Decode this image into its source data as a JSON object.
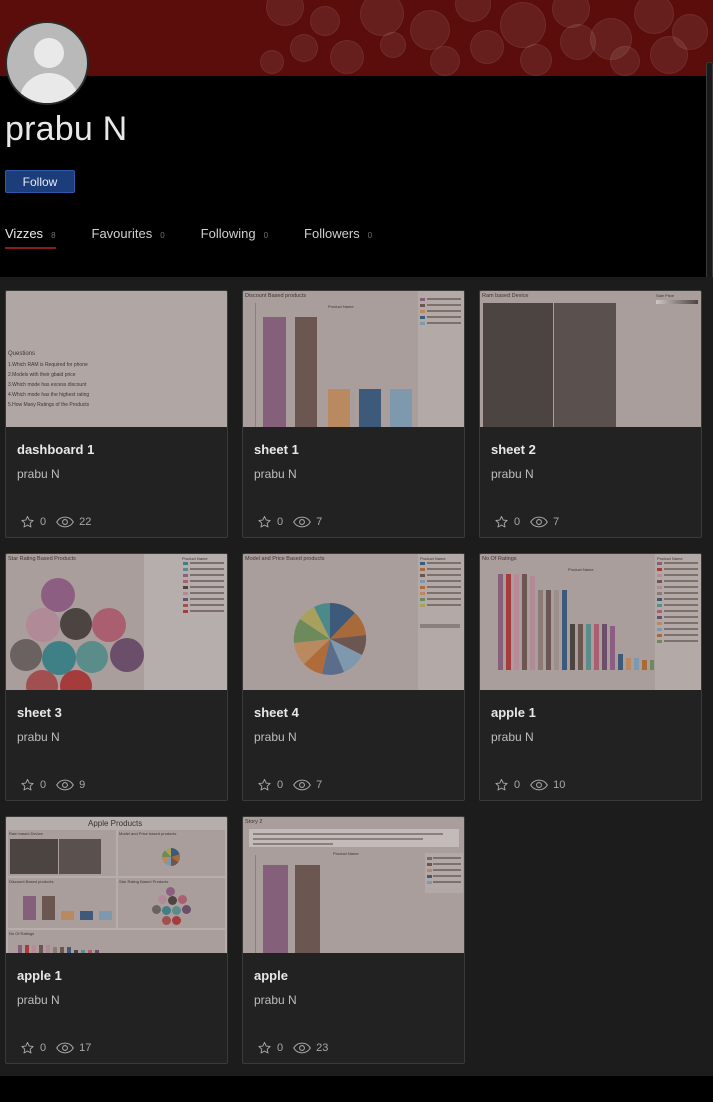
{
  "profile": {
    "name": "prabu N",
    "follow_label": "Follow"
  },
  "tabs": [
    {
      "label": "Vizzes",
      "count": "8",
      "active": true
    },
    {
      "label": "Favourites",
      "count": "0",
      "active": false
    },
    {
      "label": "Following",
      "count": "0",
      "active": false
    },
    {
      "label": "Followers",
      "count": "0",
      "active": false
    }
  ],
  "cards": [
    {
      "title": "dashboard 1",
      "author": "prabu N",
      "favorites": "0",
      "views": "22",
      "thumb": {
        "heading": "Questions",
        "lines": [
          "1.Which RAM is Required for phone",
          "2.Models with their gbaid price",
          "3.Which mode has excess discount",
          "4.Which mode has the highest rating",
          "5.How Many Ratings of the Products"
        ]
      }
    },
    {
      "title": "sheet 1",
      "author": "prabu N",
      "favorites": "0",
      "views": "7",
      "thumb": {
        "heading": "Discount Based products",
        "subheading": "Product Name"
      }
    },
    {
      "title": "sheet 2",
      "author": "prabu N",
      "favorites": "0",
      "views": "7",
      "thumb": {
        "heading": "Ram based Device",
        "legend_title": "Sale Price"
      }
    },
    {
      "title": "sheet 3",
      "author": "prabu N",
      "favorites": "0",
      "views": "9",
      "thumb": {
        "heading": "Star Rating Based Products",
        "legend_title": "Product Name"
      }
    },
    {
      "title": "sheet 4",
      "author": "prabu N",
      "favorites": "0",
      "views": "7",
      "thumb": {
        "heading": "Model and Price Based products",
        "legend_title": "Product Name"
      }
    },
    {
      "title": "apple 1",
      "author": "prabu N",
      "favorites": "0",
      "views": "10",
      "thumb": {
        "heading": "No Of Ratings",
        "subheading": "Product Name",
        "legend_title": "Product Name"
      }
    },
    {
      "title": "apple 1",
      "author": "prabu N",
      "favorites": "0",
      "views": "17",
      "thumb": {
        "heading": "Apple Products",
        "panels": [
          "Ram based Device",
          "Model and Price based products",
          "Discount Based products",
          "Star Rating Based Products",
          "No Of Ratings"
        ]
      }
    },
    {
      "title": "apple",
      "author": "prabu N",
      "favorites": "0",
      "views": "23",
      "thumb": {
        "heading": "Story 2",
        "subheading": "Product Name"
      }
    }
  ],
  "colors": {
    "banner": "#5a0d0a",
    "follow_button": "#1d3d7a",
    "active_tab_underline": "#8a1d1a",
    "card_background": "#222222",
    "page_background": "#000000"
  },
  "icons": {
    "favorite": "star-icon",
    "views": "eye-icon"
  }
}
